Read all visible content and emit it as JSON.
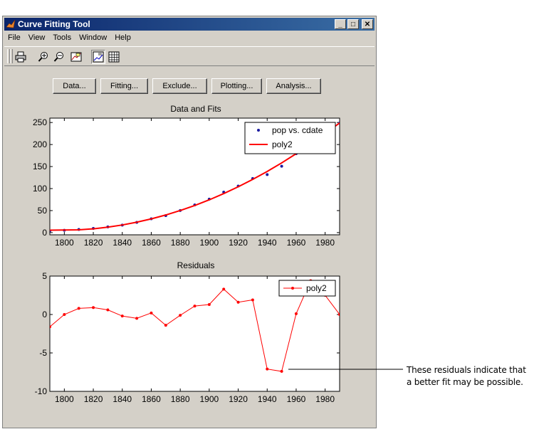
{
  "window": {
    "title": "Curve Fitting Tool",
    "controls": {
      "minimize": "_",
      "maximize": "□",
      "close": "✕"
    }
  },
  "menu": [
    "File",
    "View",
    "Tools",
    "Window",
    "Help"
  ],
  "toolbar": [
    "print-icon",
    "zoom-in-icon",
    "zoom-out-icon",
    "data-cursor-icon",
    "legend-icon",
    "grid-icon"
  ],
  "buttons": [
    "Data...",
    "Fitting...",
    "Exclude...",
    "Plotting...",
    "Analysis..."
  ],
  "chart_data": [
    {
      "type": "scatter",
      "title": "Data and Fits",
      "xlim": [
        1790,
        1990
      ],
      "ylim": [
        -5,
        260
      ],
      "xticks": [
        1800,
        1820,
        1840,
        1860,
        1880,
        1900,
        1920,
        1940,
        1960,
        1980
      ],
      "yticks": [
        0,
        50,
        100,
        150,
        200,
        250
      ],
      "legend_position": "top-right",
      "series": [
        {
          "name": "pop vs. cdate",
          "style": "points",
          "color": "#1a1aa0",
          "x": [
            1790,
            1800,
            1810,
            1820,
            1830,
            1840,
            1850,
            1860,
            1870,
            1880,
            1890,
            1900,
            1910,
            1920,
            1930,
            1940,
            1950,
            1960,
            1970,
            1980,
            1990
          ],
          "y": [
            3.9,
            5.3,
            7.2,
            9.6,
            12.9,
            17.1,
            23.2,
            31.4,
            38.6,
            50.2,
            62.9,
            76.0,
            92.0,
            105.7,
            122.8,
            131.7,
            150.7,
            179.3,
            203.3,
            226.5,
            248.7
          ]
        },
        {
          "name": "poly2",
          "style": "line",
          "color": "#ff0000",
          "x": [
            1790,
            1800,
            1810,
            1820,
            1830,
            1840,
            1850,
            1860,
            1870,
            1880,
            1890,
            1900,
            1910,
            1920,
            1930,
            1940,
            1950,
            1960,
            1970,
            1980,
            1990
          ],
          "y": [
            5.5,
            6.0,
            6.3,
            8.6,
            12.3,
            17.3,
            23.7,
            31.2,
            40.0,
            50.2,
            61.6,
            74.4,
            88.6,
            104.1,
            120.8,
            138.9,
            158.3,
            179.2,
            201.4,
            224.8,
            249.0
          ]
        }
      ]
    },
    {
      "type": "line",
      "title": "Residuals",
      "xlim": [
        1790,
        1990
      ],
      "ylim": [
        -10,
        5
      ],
      "xticks": [
        1800,
        1820,
        1840,
        1860,
        1880,
        1900,
        1920,
        1940,
        1960,
        1980
      ],
      "yticks": [
        -10,
        -5,
        0,
        5
      ],
      "legend_position": "top-right",
      "series": [
        {
          "name": "poly2",
          "color": "#ff0000",
          "x": [
            1790,
            1800,
            1810,
            1820,
            1830,
            1840,
            1850,
            1860,
            1870,
            1880,
            1890,
            1900,
            1910,
            1920,
            1930,
            1940,
            1950,
            1960,
            1970,
            1980,
            1990
          ],
          "y": [
            -1.6,
            0.0,
            0.8,
            0.9,
            0.6,
            -0.2,
            -0.5,
            0.2,
            -1.4,
            -0.1,
            1.1,
            1.3,
            3.3,
            1.6,
            1.9,
            -7.1,
            -7.4,
            0.1,
            4.4,
            2.5,
            0.0
          ]
        }
      ]
    }
  ],
  "annotation": {
    "line1": "These residuals indicate that",
    "line2": "a better fit may be possible."
  }
}
